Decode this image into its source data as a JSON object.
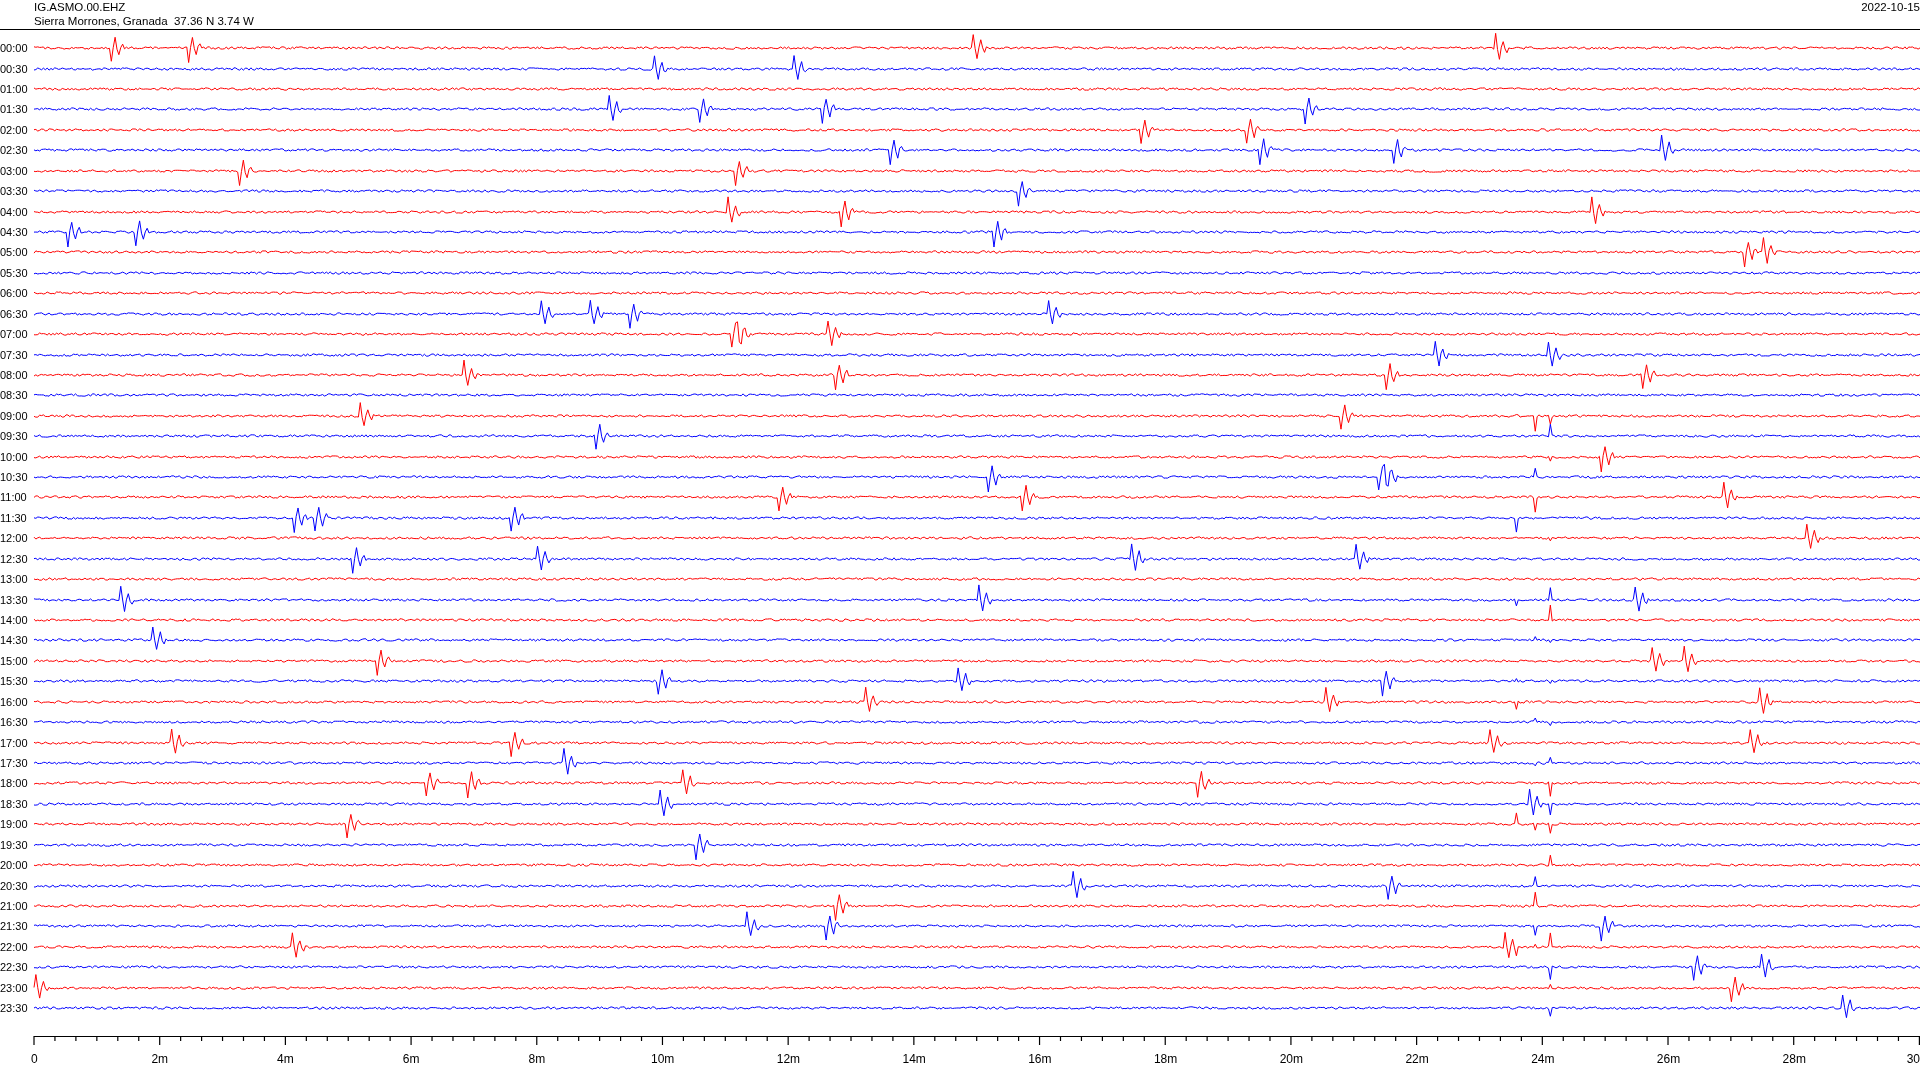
{
  "header": {
    "station": "IG.ASMO.00.EHZ",
    "location": "Sierra Morrones, Granada  37.36 N 3.74 W",
    "date": "2022-10-15"
  },
  "rows": [
    {
      "time": "00:00",
      "color": "#ff0000"
    },
    {
      "time": "00:30",
      "color": "#0000ff"
    },
    {
      "time": "01:00",
      "color": "#ff0000"
    },
    {
      "time": "01:30",
      "color": "#0000ff"
    },
    {
      "time": "02:00",
      "color": "#ff0000"
    },
    {
      "time": "02:30",
      "color": "#0000ff"
    },
    {
      "time": "03:00",
      "color": "#ff0000"
    },
    {
      "time": "03:30",
      "color": "#0000ff"
    },
    {
      "time": "04:00",
      "color": "#ff0000"
    },
    {
      "time": "04:30",
      "color": "#0000ff"
    },
    {
      "time": "05:00",
      "color": "#ff0000"
    },
    {
      "time": "05:30",
      "color": "#0000ff"
    },
    {
      "time": "06:00",
      "color": "#ff0000"
    },
    {
      "time": "06:30",
      "color": "#0000ff"
    },
    {
      "time": "07:00",
      "color": "#ff0000"
    },
    {
      "time": "07:30",
      "color": "#0000ff"
    },
    {
      "time": "08:00",
      "color": "#ff0000"
    },
    {
      "time": "08:30",
      "color": "#0000ff"
    },
    {
      "time": "09:00",
      "color": "#ff0000"
    },
    {
      "time": "09:30",
      "color": "#0000ff"
    },
    {
      "time": "10:00",
      "color": "#ff0000"
    },
    {
      "time": "10:30",
      "color": "#0000ff"
    },
    {
      "time": "11:00",
      "color": "#ff0000"
    },
    {
      "time": "11:30",
      "color": "#0000ff"
    },
    {
      "time": "12:00",
      "color": "#ff0000"
    },
    {
      "time": "12:30",
      "color": "#0000ff"
    },
    {
      "time": "13:00",
      "color": "#ff0000"
    },
    {
      "time": "13:30",
      "color": "#0000ff"
    },
    {
      "time": "14:00",
      "color": "#ff0000"
    },
    {
      "time": "14:30",
      "color": "#0000ff"
    },
    {
      "time": "15:00",
      "color": "#ff0000"
    },
    {
      "time": "15:30",
      "color": "#0000ff"
    },
    {
      "time": "16:00",
      "color": "#ff0000"
    },
    {
      "time": "16:30",
      "color": "#0000ff"
    },
    {
      "time": "17:00",
      "color": "#ff0000"
    },
    {
      "time": "17:30",
      "color": "#0000ff"
    },
    {
      "time": "18:00",
      "color": "#ff0000"
    },
    {
      "time": "18:30",
      "color": "#0000ff"
    },
    {
      "time": "19:00",
      "color": "#ff0000"
    },
    {
      "time": "19:30",
      "color": "#0000ff"
    },
    {
      "time": "20:00",
      "color": "#ff0000"
    },
    {
      "time": "20:30",
      "color": "#0000ff"
    },
    {
      "time": "21:00",
      "color": "#ff0000"
    },
    {
      "time": "21:30",
      "color": "#0000ff"
    },
    {
      "time": "22:00",
      "color": "#ff0000"
    },
    {
      "time": "22:30",
      "color": "#0000ff"
    },
    {
      "time": "23:00",
      "color": "#ff0000"
    },
    {
      "time": "23:30",
      "color": "#0000ff"
    }
  ],
  "x_axis": {
    "ticks": [
      "0",
      "2m",
      "4m",
      "6m",
      "8m",
      "10m",
      "12m",
      "14m",
      "16m",
      "18m",
      "20m",
      "22m",
      "24m",
      "26m",
      "28m",
      "30"
    ]
  }
}
